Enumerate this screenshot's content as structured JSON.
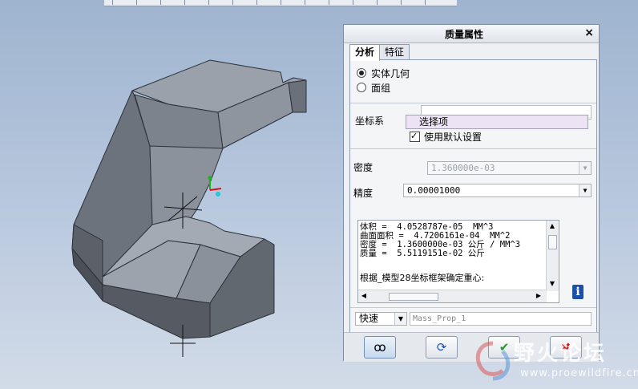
{
  "dialog": {
    "title": "质量属性",
    "close_label": "×",
    "tabs": [
      {
        "label": "分析",
        "active": true
      },
      {
        "label": "特征",
        "active": false
      }
    ],
    "radio_solid": "实体几何",
    "radio_surface": "面组",
    "coordinate_label": "坐标系",
    "coordinate_value": "选择项",
    "use_default_label": "使用默认设置",
    "use_default_checked": true,
    "density_label": "密度",
    "density_value": "1.360000e-03",
    "precision_label": "精度",
    "precision_value": "0.00001000",
    "results": {
      "lines": [
        "体积 =  4.0528787e-05  MM^3",
        "曲面面积 =  4.7206161e-04  MM^2",
        "密度 =  1.3600000e-03 公斤 / MM^3",
        "质量 =  5.5119151e-02 公斤"
      ],
      "note": "根据_模型28坐标框架确定重心:"
    },
    "mode_value": "快速",
    "name_value": "Mass_Prop_1",
    "buttons": {
      "inspect": "ꝏ",
      "repeat": "⟳",
      "ok": "✔",
      "cancel": "✖"
    }
  },
  "watermark": {
    "text": "野火论坛",
    "url": "www.proewildfire.cn"
  },
  "colors": {
    "viewport_top": "#9fb4cf",
    "viewport_bottom": "#d2dbe8",
    "model_face": "#8a929d",
    "info_blue": "#1d4ea8"
  }
}
